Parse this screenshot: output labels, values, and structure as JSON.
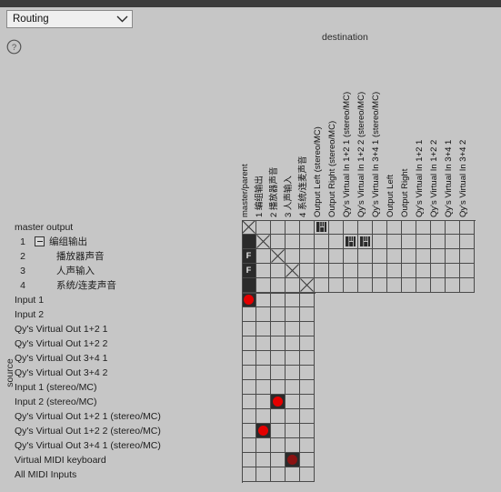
{
  "window": {
    "mode_selector": {
      "value": "Routing",
      "icon": "chevron-down-icon"
    },
    "help_button": {
      "icon": "question-circle-icon",
      "label": "?"
    }
  },
  "axes": {
    "destination_label": "destination",
    "source_label": "source"
  },
  "colors": {
    "background": "#c6c6c6",
    "grid_line": "#4a4a4a",
    "connection_active": "#e40000",
    "connection_muted": "#8b1212",
    "block": "#2b2b2b",
    "titlebar": "#3c3c3c"
  },
  "columns": [
    {
      "id": "master-parent",
      "label": "master/parent"
    },
    {
      "id": "col-1",
      "label": "1  编组输出"
    },
    {
      "id": "col-2",
      "label": "2  播放器声音"
    },
    {
      "id": "col-3",
      "label": "3  人声输入"
    },
    {
      "id": "col-4",
      "label": "4  系统/连麦声音"
    },
    {
      "id": "output-left-stereo-mc",
      "label": "Output Left (stereo/MC)"
    },
    {
      "id": "output-right-stereo-mc",
      "label": "Output Right (stereo/MC)"
    },
    {
      "id": "qy-virtual-in-1p2-1-stereo-mc",
      "label": "Qy's Virtual In 1+2 1 (stereo/MC)"
    },
    {
      "id": "qy-virtual-in-1p2-2-stereo-mc",
      "label": "Qy's Virtual In 1+2 2 (stereo/MC)"
    },
    {
      "id": "qy-virtual-in-3p4-1-stereo-mc",
      "label": "Qy's Virtual In 3+4 1 (stereo/MC)"
    },
    {
      "id": "output-left",
      "label": "Output Left"
    },
    {
      "id": "output-right",
      "label": "Output Right"
    },
    {
      "id": "qy-virtual-in-1p2-1",
      "label": "Qy's Virtual In 1+2 1"
    },
    {
      "id": "qy-virtual-in-1p2-2",
      "label": "Qy's Virtual In 1+2 2"
    },
    {
      "id": "qy-virtual-in-3p4-1",
      "label": "Qy's Virtual In 3+4 1"
    },
    {
      "id": "qy-virtual-in-3p4-2",
      "label": "Qy's Virtual In 3+4 2"
    }
  ],
  "rows": [
    {
      "id": "master-output",
      "num": "",
      "label": "master output",
      "indent": 0,
      "expander": false,
      "cells": 16
    },
    {
      "id": "group-output",
      "num": "1",
      "label": "编组输出",
      "indent": 1,
      "expander": true,
      "cells": 16
    },
    {
      "id": "player-sound",
      "num": "2",
      "label": "播放器声音",
      "indent": 2,
      "expander": false,
      "cells": 16
    },
    {
      "id": "voice-input",
      "num": "3",
      "label": "人声输入",
      "indent": 2,
      "expander": false,
      "cells": 16
    },
    {
      "id": "system-mic-sound",
      "num": "4",
      "label": "系统/连麦声音",
      "indent": 2,
      "expander": false,
      "cells": 16
    },
    {
      "id": "input-1",
      "num": "",
      "label": "Input 1",
      "indent": 0,
      "expander": false,
      "cells": 5
    },
    {
      "id": "input-2",
      "num": "",
      "label": "Input 2",
      "indent": 0,
      "expander": false,
      "cells": 5
    },
    {
      "id": "qy-virtual-out-1p2-1",
      "num": "",
      "label": "Qy's Virtual Out 1+2 1",
      "indent": 0,
      "expander": false,
      "cells": 5
    },
    {
      "id": "qy-virtual-out-1p2-2",
      "num": "",
      "label": "Qy's Virtual Out 1+2 2",
      "indent": 0,
      "expander": false,
      "cells": 5
    },
    {
      "id": "qy-virtual-out-3p4-1",
      "num": "",
      "label": "Qy's Virtual Out 3+4 1",
      "indent": 0,
      "expander": false,
      "cells": 5
    },
    {
      "id": "qy-virtual-out-3p4-2",
      "num": "",
      "label": "Qy's Virtual Out 3+4 2",
      "indent": 0,
      "expander": false,
      "cells": 5
    },
    {
      "id": "input-1-stereo-mc",
      "num": "",
      "label": "Input 1 (stereo/MC)",
      "indent": 0,
      "expander": false,
      "cells": 5
    },
    {
      "id": "input-2-stereo-mc",
      "num": "",
      "label": "Input 2 (stereo/MC)",
      "indent": 0,
      "expander": false,
      "cells": 5
    },
    {
      "id": "qy-virtual-out-1p2-1-smc",
      "num": "",
      "label": "Qy's Virtual Out 1+2 1 (stereo/MC)",
      "indent": 0,
      "expander": false,
      "cells": 5
    },
    {
      "id": "qy-virtual-out-1p2-2-smc",
      "num": "",
      "label": "Qy's Virtual Out 1+2 2 (stereo/MC)",
      "indent": 0,
      "expander": false,
      "cells": 5
    },
    {
      "id": "qy-virtual-out-3p4-1-smc",
      "num": "",
      "label": "Qy's Virtual Out 3+4 1 (stereo/MC)",
      "indent": 0,
      "expander": false,
      "cells": 5
    },
    {
      "id": "virtual-midi-keyboard",
      "num": "",
      "label": "Virtual MIDI keyboard",
      "indent": 0,
      "expander": false,
      "cells": 5
    },
    {
      "id": "all-midi-inputs",
      "num": "",
      "label": "All MIDI Inputs",
      "indent": 0,
      "expander": false,
      "cells": 5
    }
  ],
  "matrix": [
    {
      "row": 0,
      "col": 0,
      "mark": "x",
      "name": "cell-master-output-master-parent"
    },
    {
      "row": 0,
      "col": 5,
      "mark": "midi",
      "name": "cell-master-output-output-left-stereo-mc"
    },
    {
      "row": 1,
      "col": 0,
      "mark": "block",
      "name": "cell-group-output-master-parent"
    },
    {
      "row": 1,
      "col": 1,
      "mark": "x",
      "name": "cell-group-output-col-1"
    },
    {
      "row": 1,
      "col": 7,
      "mark": "midi",
      "name": "cell-group-output-qy-virtual-in-1p2-1-stereo-mc"
    },
    {
      "row": 1,
      "col": 8,
      "mark": "midi",
      "name": "cell-group-output-qy-virtual-in-1p2-2-stereo-mc"
    },
    {
      "row": 2,
      "col": 0,
      "mark": "f",
      "name": "cell-player-sound-master-parent"
    },
    {
      "row": 2,
      "col": 2,
      "mark": "x",
      "name": "cell-player-sound-col-2"
    },
    {
      "row": 3,
      "col": 0,
      "mark": "f",
      "name": "cell-voice-input-master-parent"
    },
    {
      "row": 3,
      "col": 3,
      "mark": "x",
      "name": "cell-voice-input-col-3"
    },
    {
      "row": 4,
      "col": 0,
      "mark": "block",
      "name": "cell-system-mic-sound-master-parent"
    },
    {
      "row": 4,
      "col": 4,
      "mark": "x",
      "name": "cell-system-mic-sound-col-4"
    },
    {
      "row": 5,
      "col": 0,
      "mark": "dot",
      "name": "cell-input-1-master-parent"
    },
    {
      "row": 12,
      "col": 2,
      "mark": "dot",
      "name": "cell-input-2-stereo-mc-col-2"
    },
    {
      "row": 14,
      "col": 1,
      "mark": "dot",
      "name": "cell-qy-virtual-out-1p2-2-smc-col-1"
    },
    {
      "row": 16,
      "col": 3,
      "mark": "dot-muted",
      "name": "cell-virtual-midi-keyboard-col-3"
    }
  ],
  "f_marker_label": "F"
}
